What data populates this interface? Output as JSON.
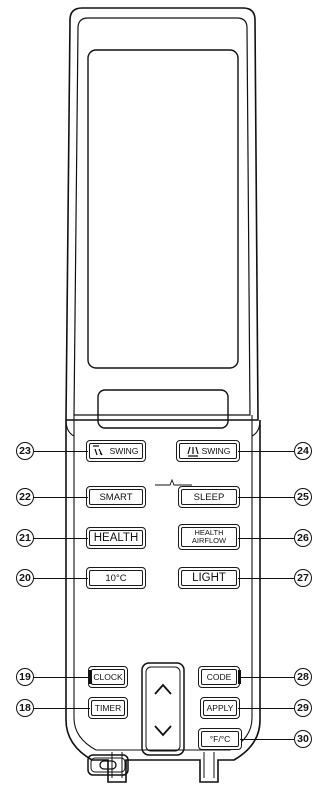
{
  "buttons": {
    "swing_v": "SWING",
    "swing_h": "SWING",
    "smart": "SMART",
    "sleep": "SLEEP",
    "health": "HEALTH",
    "health_airflow": "HEALTH\nAIRFLOW",
    "ten_c": "10°C",
    "light": "LIGHT",
    "clock": "CLOCK",
    "code": "CODE",
    "timer": "TIMER",
    "apply": "APPLY",
    "temp_unit": "°F/°C"
  },
  "callouts": {
    "c18": "18",
    "c19": "19",
    "c20": "20",
    "c21": "21",
    "c22": "22",
    "c23": "23",
    "c24": "24",
    "c25": "25",
    "c26": "26",
    "c27": "27",
    "c28": "28",
    "c29": "29",
    "c30": "30"
  }
}
